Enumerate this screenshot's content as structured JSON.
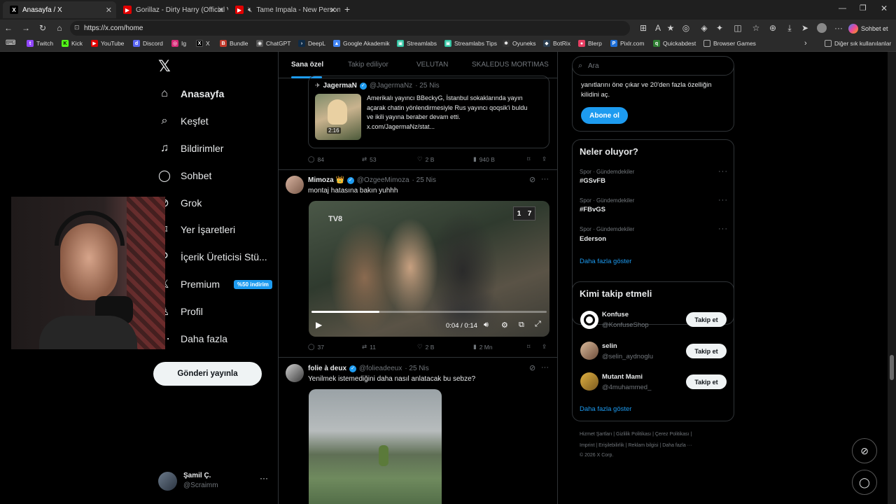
{
  "browser": {
    "tabs": [
      {
        "title": "Anasayfa / X",
        "icon": "x-logo-icon",
        "active": true
      },
      {
        "title": "Gorillaz - Dirty Harry (Official Vide",
        "icon": "youtube-icon",
        "active": false
      },
      {
        "title": "Tame Impala - New Person, Sa",
        "icon": "youtube-icon",
        "active": false
      }
    ],
    "new_tab": "+",
    "url": "https://x.com/home",
    "profile_chat": "Sohbet et",
    "bookmarks": [
      "Twitch",
      "Kick",
      "YouTube",
      "Discord",
      "Ig",
      "X",
      "Bundle",
      "ChatGPT",
      "DeepL",
      "Google Akademik",
      "Streamlabs",
      "Streamlabs Tips",
      "Oyuneks",
      "BotRix",
      "Blerp",
      "Pixlr.com",
      "Quickabdest",
      "Browser Games"
    ],
    "other_bookmarks": "Diğer sık kullanılanlar"
  },
  "nav": {
    "items": [
      {
        "label": "Anasayfa",
        "icon": "home-icon"
      },
      {
        "label": "Keşfet",
        "icon": "search-icon"
      },
      {
        "label": "Bildirimler",
        "icon": "bell-icon"
      },
      {
        "label": "Sohbet",
        "icon": "chat-icon"
      },
      {
        "label": "Grok",
        "icon": "grok-icon"
      },
      {
        "label": "Yer İşaretleri",
        "icon": "bookmark-icon"
      },
      {
        "label": "İçerik Üreticisi Stü...",
        "icon": "creator-studio-icon"
      },
      {
        "label": "Premium",
        "icon": "premium-icon",
        "badge": "%50 indirim"
      },
      {
        "label": "Profil",
        "icon": "profile-icon"
      },
      {
        "label": "Daha fazla",
        "icon": "more-circle-icon"
      }
    ],
    "post_button": "Gönderi yayınla",
    "account": {
      "name": "Şamil Ç.",
      "handle": "@Scraimm",
      "more": "···"
    }
  },
  "feed": {
    "tabs": [
      "Sana özel",
      "Takip ediliyor",
      "VELUTAN",
      "SKALEDUS MORTIMAS"
    ],
    "quoted": {
      "name": "JagermaN",
      "handle": "@JagermaNz",
      "date": "· 25 Nis",
      "text_lines": [
        "Amerikalı yayıncı BBeckyG, İstanbul sokaklarında yayın",
        "açarak chatin yönlendirmesiyle Rus yayıncı qoqsik'i buldu",
        "ve ikili yayına beraber devam etti.",
        "x.com/JagermaNz/stat..."
      ],
      "thumb_duration": "2:16"
    },
    "post1_actions": {
      "replies": "84",
      "reposts": "53",
      "likes": "2 B",
      "views": "940 B"
    },
    "post2": {
      "name": "Mimoza 👑",
      "handle": "@OzgeeMimoza",
      "date": "· 25 Nis",
      "text": "montaj hatasına bakın yuhhh",
      "video_time": "0:04 / 0:14",
      "watermark": "TV8",
      "score_left": "1",
      "score_right": "7",
      "actions": {
        "replies": "37",
        "reposts": "11",
        "likes": "2 B",
        "views": "2 Mn"
      }
    },
    "post3": {
      "name": "folie à deux",
      "handle": "@folieadeeux",
      "date": "· 25 Nis",
      "text": "Yenilmek istemediğini daha nasıl anlatacak bu sebze?"
    }
  },
  "right": {
    "search_placeholder": "Ara",
    "premium_lines": [
      "yanıtlarını öne çıkar ve 20'den fazla özelliğin",
      "kilidini aç."
    ],
    "subscribe": "Abone ol",
    "trends_title": "Neler oluyor?",
    "trends": [
      {
        "category": "Spor · Gündemdekiler",
        "name": "#GSvFB"
      },
      {
        "category": "Spor · Gündemdekiler",
        "name": "#FBvGS"
      },
      {
        "category": "Spor · Gündemdekiler",
        "name": "Ederson"
      }
    ],
    "show_more": "Daha fazla göster",
    "who_title": "Kimi takip etmeli",
    "who": [
      {
        "name": "Konfuse",
        "handle": "@KonfuseShop"
      },
      {
        "name": "selin",
        "handle": "@selin_aydnoglu"
      },
      {
        "name": "Mutant Mami",
        "handle": "@4muhammed_"
      }
    ],
    "follow_label": "Takip et",
    "footer_line1": "Hizmet Şartları  |  Gizlilik Politikası  |  Çerez Politikası  |",
    "footer_line2": "Imprint  |  Erişilebilirlik  |  Reklam bilgisi  |  Daha fazla ···",
    "copyright": "© 2026 X Corp."
  },
  "colors": {
    "accent": "#1d9bf0",
    "background": "#000000",
    "border": "#2f3336",
    "muted": "#71767b"
  }
}
